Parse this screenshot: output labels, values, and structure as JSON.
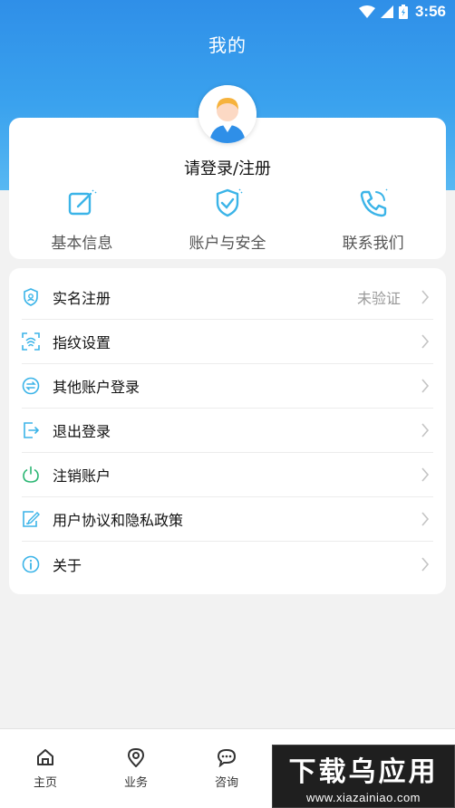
{
  "status_bar": {
    "time": "3:56"
  },
  "header": {
    "title": "我的"
  },
  "profile": {
    "login_text": "请登录/注册"
  },
  "shortcuts": [
    {
      "label": "基本信息",
      "icon": "edit-icon"
    },
    {
      "label": "账户与安全",
      "icon": "shield-check-icon"
    },
    {
      "label": "联系我们",
      "icon": "phone-icon"
    }
  ],
  "menu": [
    {
      "label": "实名注册",
      "value": "未验证",
      "icon": "id-shield-icon"
    },
    {
      "label": "指纹设置",
      "value": "",
      "icon": "fingerprint-icon"
    },
    {
      "label": "其他账户登录",
      "value": "",
      "icon": "swap-icon"
    },
    {
      "label": "退出登录",
      "value": "",
      "icon": "logout-icon"
    },
    {
      "label": "注销账户",
      "value": "",
      "icon": "power-icon"
    },
    {
      "label": "用户协议和隐私政策",
      "value": "",
      "icon": "document-pen-icon"
    },
    {
      "label": "关于",
      "value": "",
      "icon": "info-icon"
    }
  ],
  "tabbar": [
    {
      "label": "主页",
      "icon": "home-icon"
    },
    {
      "label": "业务",
      "icon": "location-icon"
    },
    {
      "label": "咨询",
      "icon": "chat-icon"
    }
  ],
  "watermark": {
    "title": "下载乌应用",
    "url": "www.xiazainiao.com"
  },
  "colors": {
    "header_blue": "#2f8fe8",
    "accent": "#3bb4e8",
    "power_green": "#2bb673"
  }
}
